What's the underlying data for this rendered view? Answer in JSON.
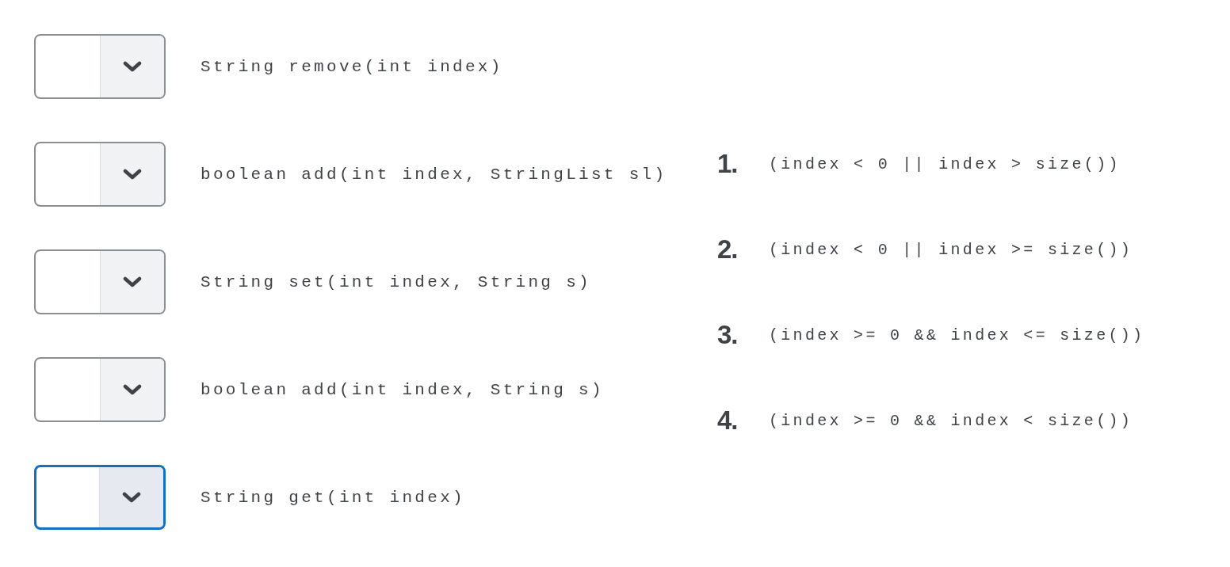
{
  "questions": [
    {
      "prompt": "String remove(int index)",
      "focused": false
    },
    {
      "prompt": "boolean add(int index, StringList sl)",
      "focused": false
    },
    {
      "prompt": "String set(int index, String s)",
      "focused": false
    },
    {
      "prompt": "boolean add(int index, String s)",
      "focused": false
    },
    {
      "prompt": "String get(int index)",
      "focused": true
    }
  ],
  "options": [
    {
      "number": "1.",
      "text": "(index < 0 || index > size())"
    },
    {
      "number": "2.",
      "text": "(index < 0 || index >= size())"
    },
    {
      "number": "3.",
      "text": "(index >= 0 && index <= size())"
    },
    {
      "number": "4.",
      "text": "(index >= 0 && index < size())"
    }
  ]
}
